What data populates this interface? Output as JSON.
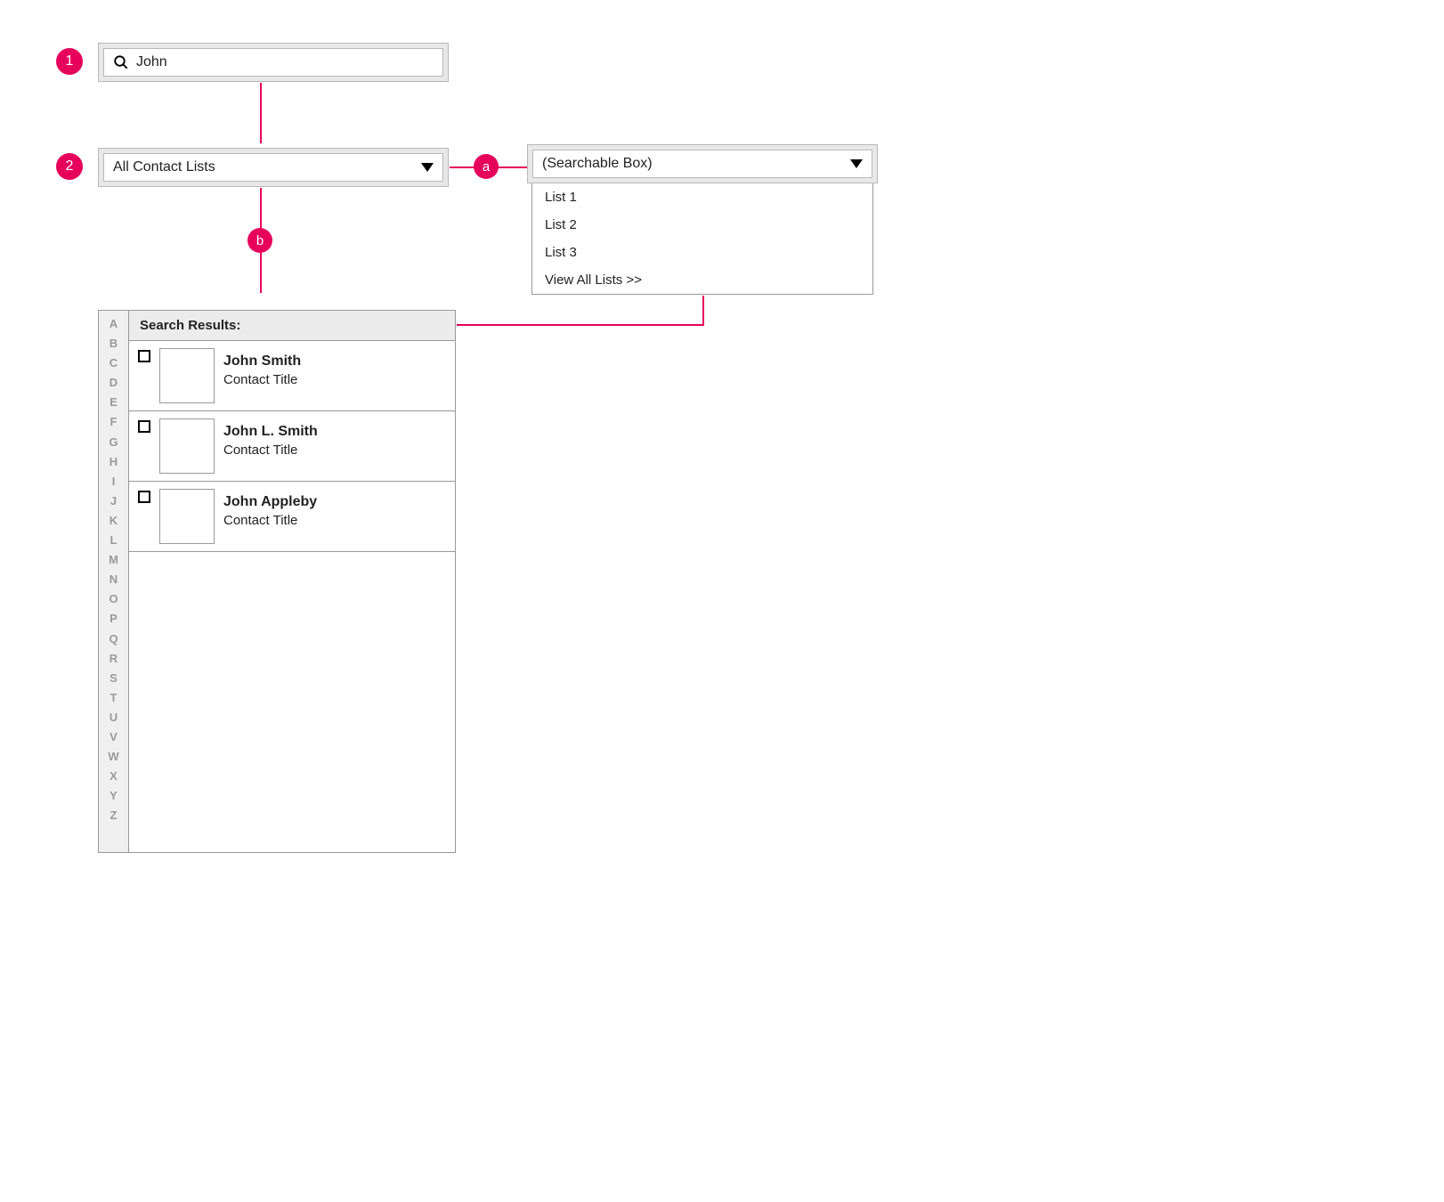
{
  "callouts": {
    "one": "1",
    "two": "2",
    "a": "a",
    "b": "b"
  },
  "search": {
    "value": "John"
  },
  "filter": {
    "selected": "All Contact Lists"
  },
  "dropdown": {
    "placeholder": "(Searchable Box)",
    "items": [
      "List 1",
      "List 2",
      "List 3",
      "View All Lists >>"
    ]
  },
  "results": {
    "header": "Search Results:",
    "items": [
      {
        "name": "John Smith",
        "title": "Contact Title"
      },
      {
        "name": "John L. Smith",
        "title": "Contact Title"
      },
      {
        "name": "John Appleby",
        "title": "Contact Title"
      }
    ]
  },
  "alpha_index": [
    "A",
    "B",
    "C",
    "D",
    "E",
    "F",
    "G",
    "H",
    "I",
    "J",
    "K",
    "L",
    "M",
    "N",
    "O",
    "P",
    "Q",
    "R",
    "S",
    "T",
    "U",
    "V",
    "W",
    "X",
    "Y",
    "Z"
  ]
}
